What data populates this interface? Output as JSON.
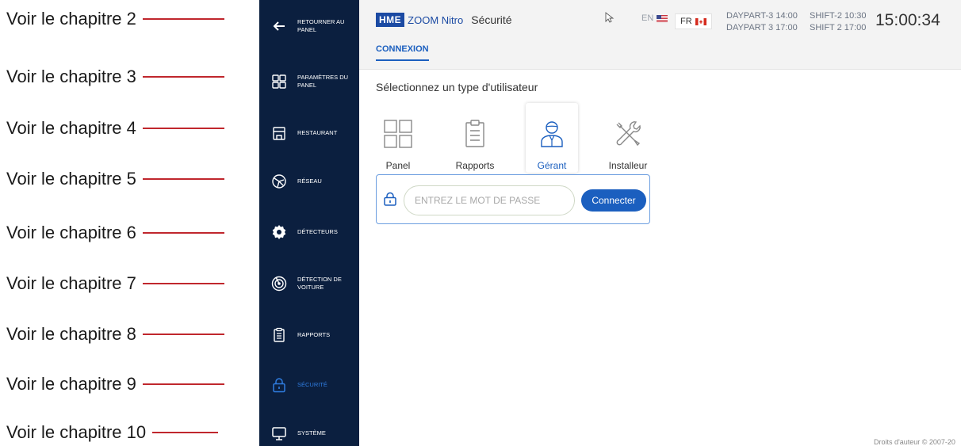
{
  "annotations": [
    {
      "label": "Voir le chapitre 2"
    },
    {
      "label": "Voir le chapitre 3"
    },
    {
      "label": "Voir le chapitre 4"
    },
    {
      "label": "Voir le chapitre 5"
    },
    {
      "label": "Voir le chapitre 6"
    },
    {
      "label": "Voir le chapitre 7"
    },
    {
      "label": "Voir le chapitre 8"
    },
    {
      "label": "Voir le chapitre 9"
    },
    {
      "label": "Voir le chapitre 10"
    }
  ],
  "sidebar": {
    "items": [
      {
        "label": "RETOURNER AU PANEL",
        "icon": "arrow-left-icon"
      },
      {
        "label": "PARAMÈTRES DU PANEL",
        "icon": "grid-icon"
      },
      {
        "label": "RESTAURANT",
        "icon": "store-icon"
      },
      {
        "label": "RÉSEAU",
        "icon": "network-icon"
      },
      {
        "label": "DÉTECTEURS",
        "icon": "gear-icon"
      },
      {
        "label": "DÉTECTION DE VOITURE",
        "icon": "radar-icon"
      },
      {
        "label": "RAPPORTS",
        "icon": "clipboard-icon"
      },
      {
        "label": "SÉCURITÉ",
        "icon": "lock-icon",
        "active": true
      },
      {
        "label": "SYSTÈME",
        "icon": "monitor-icon"
      }
    ],
    "colors": {
      "background": "#0b1f3f",
      "active": "#2f7de1"
    }
  },
  "header": {
    "brand_hme": "HME",
    "brand_zoom": "ZOOM Nitro",
    "page_title": "Sécurité",
    "lang_en": "EN",
    "lang_fr": "FR",
    "daypart_a": "DAYPART-3 14:00",
    "daypart_b": "DAYPART 3 17:00",
    "shift_a": "SHIFT-2 10:30",
    "shift_b": "SHIFT 2 17:00",
    "clock": "15:00:34",
    "tab": "CONNEXION"
  },
  "main": {
    "select_title": "Sélectionnez un type d'utilisateur",
    "user_types": [
      {
        "label": "Panel",
        "icon": "grid-icon"
      },
      {
        "label": "Rapports",
        "icon": "clipboard-icon"
      },
      {
        "label": "Gérant",
        "icon": "manager-icon",
        "selected": true
      },
      {
        "label": "Installeur",
        "icon": "tools-icon"
      }
    ],
    "password_placeholder": "ENTREZ LE MOT DE PASSE",
    "connect_label": "Connecter"
  },
  "footer": {
    "copyright": "Droits d'auteur © 2007-20"
  },
  "colors": {
    "accent": "#1b5fbf",
    "annotation_line": "#c0272d"
  }
}
